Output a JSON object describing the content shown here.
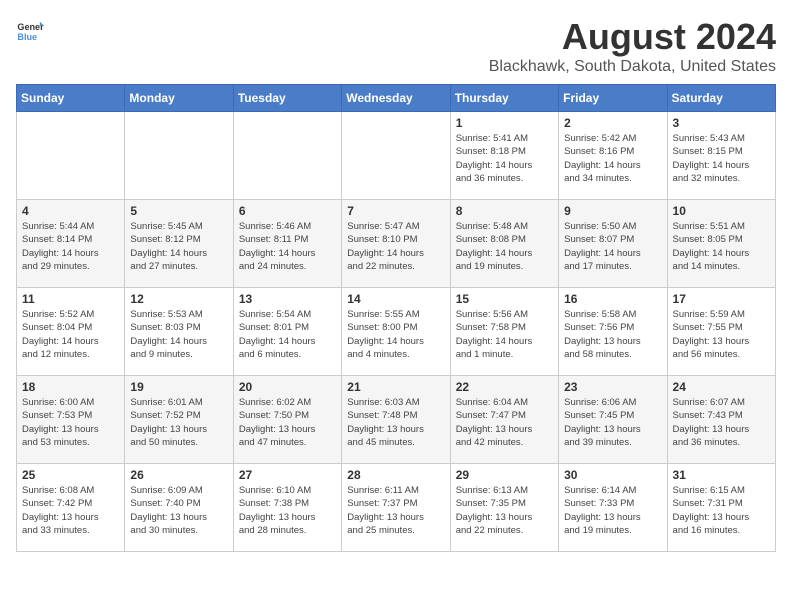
{
  "logo": {
    "text_general": "General",
    "text_blue": "Blue"
  },
  "title": "August 2024",
  "location": "Blackhawk, South Dakota, United States",
  "days_of_week": [
    "Sunday",
    "Monday",
    "Tuesday",
    "Wednesday",
    "Thursday",
    "Friday",
    "Saturday"
  ],
  "weeks": [
    [
      {
        "day": "",
        "text": ""
      },
      {
        "day": "",
        "text": ""
      },
      {
        "day": "",
        "text": ""
      },
      {
        "day": "",
        "text": ""
      },
      {
        "day": "1",
        "text": "Sunrise: 5:41 AM\nSunset: 8:18 PM\nDaylight: 14 hours\nand 36 minutes."
      },
      {
        "day": "2",
        "text": "Sunrise: 5:42 AM\nSunset: 8:16 PM\nDaylight: 14 hours\nand 34 minutes."
      },
      {
        "day": "3",
        "text": "Sunrise: 5:43 AM\nSunset: 8:15 PM\nDaylight: 14 hours\nand 32 minutes."
      }
    ],
    [
      {
        "day": "4",
        "text": "Sunrise: 5:44 AM\nSunset: 8:14 PM\nDaylight: 14 hours\nand 29 minutes."
      },
      {
        "day": "5",
        "text": "Sunrise: 5:45 AM\nSunset: 8:12 PM\nDaylight: 14 hours\nand 27 minutes."
      },
      {
        "day": "6",
        "text": "Sunrise: 5:46 AM\nSunset: 8:11 PM\nDaylight: 14 hours\nand 24 minutes."
      },
      {
        "day": "7",
        "text": "Sunrise: 5:47 AM\nSunset: 8:10 PM\nDaylight: 14 hours\nand 22 minutes."
      },
      {
        "day": "8",
        "text": "Sunrise: 5:48 AM\nSunset: 8:08 PM\nDaylight: 14 hours\nand 19 minutes."
      },
      {
        "day": "9",
        "text": "Sunrise: 5:50 AM\nSunset: 8:07 PM\nDaylight: 14 hours\nand 17 minutes."
      },
      {
        "day": "10",
        "text": "Sunrise: 5:51 AM\nSunset: 8:05 PM\nDaylight: 14 hours\nand 14 minutes."
      }
    ],
    [
      {
        "day": "11",
        "text": "Sunrise: 5:52 AM\nSunset: 8:04 PM\nDaylight: 14 hours\nand 12 minutes."
      },
      {
        "day": "12",
        "text": "Sunrise: 5:53 AM\nSunset: 8:03 PM\nDaylight: 14 hours\nand 9 minutes."
      },
      {
        "day": "13",
        "text": "Sunrise: 5:54 AM\nSunset: 8:01 PM\nDaylight: 14 hours\nand 6 minutes."
      },
      {
        "day": "14",
        "text": "Sunrise: 5:55 AM\nSunset: 8:00 PM\nDaylight: 14 hours\nand 4 minutes."
      },
      {
        "day": "15",
        "text": "Sunrise: 5:56 AM\nSunset: 7:58 PM\nDaylight: 14 hours\nand 1 minute."
      },
      {
        "day": "16",
        "text": "Sunrise: 5:58 AM\nSunset: 7:56 PM\nDaylight: 13 hours\nand 58 minutes."
      },
      {
        "day": "17",
        "text": "Sunrise: 5:59 AM\nSunset: 7:55 PM\nDaylight: 13 hours\nand 56 minutes."
      }
    ],
    [
      {
        "day": "18",
        "text": "Sunrise: 6:00 AM\nSunset: 7:53 PM\nDaylight: 13 hours\nand 53 minutes."
      },
      {
        "day": "19",
        "text": "Sunrise: 6:01 AM\nSunset: 7:52 PM\nDaylight: 13 hours\nand 50 minutes."
      },
      {
        "day": "20",
        "text": "Sunrise: 6:02 AM\nSunset: 7:50 PM\nDaylight: 13 hours\nand 47 minutes."
      },
      {
        "day": "21",
        "text": "Sunrise: 6:03 AM\nSunset: 7:48 PM\nDaylight: 13 hours\nand 45 minutes."
      },
      {
        "day": "22",
        "text": "Sunrise: 6:04 AM\nSunset: 7:47 PM\nDaylight: 13 hours\nand 42 minutes."
      },
      {
        "day": "23",
        "text": "Sunrise: 6:06 AM\nSunset: 7:45 PM\nDaylight: 13 hours\nand 39 minutes."
      },
      {
        "day": "24",
        "text": "Sunrise: 6:07 AM\nSunset: 7:43 PM\nDaylight: 13 hours\nand 36 minutes."
      }
    ],
    [
      {
        "day": "25",
        "text": "Sunrise: 6:08 AM\nSunset: 7:42 PM\nDaylight: 13 hours\nand 33 minutes."
      },
      {
        "day": "26",
        "text": "Sunrise: 6:09 AM\nSunset: 7:40 PM\nDaylight: 13 hours\nand 30 minutes."
      },
      {
        "day": "27",
        "text": "Sunrise: 6:10 AM\nSunset: 7:38 PM\nDaylight: 13 hours\nand 28 minutes."
      },
      {
        "day": "28",
        "text": "Sunrise: 6:11 AM\nSunset: 7:37 PM\nDaylight: 13 hours\nand 25 minutes."
      },
      {
        "day": "29",
        "text": "Sunrise: 6:13 AM\nSunset: 7:35 PM\nDaylight: 13 hours\nand 22 minutes."
      },
      {
        "day": "30",
        "text": "Sunrise: 6:14 AM\nSunset: 7:33 PM\nDaylight: 13 hours\nand 19 minutes."
      },
      {
        "day": "31",
        "text": "Sunrise: 6:15 AM\nSunset: 7:31 PM\nDaylight: 13 hours\nand 16 minutes."
      }
    ]
  ]
}
